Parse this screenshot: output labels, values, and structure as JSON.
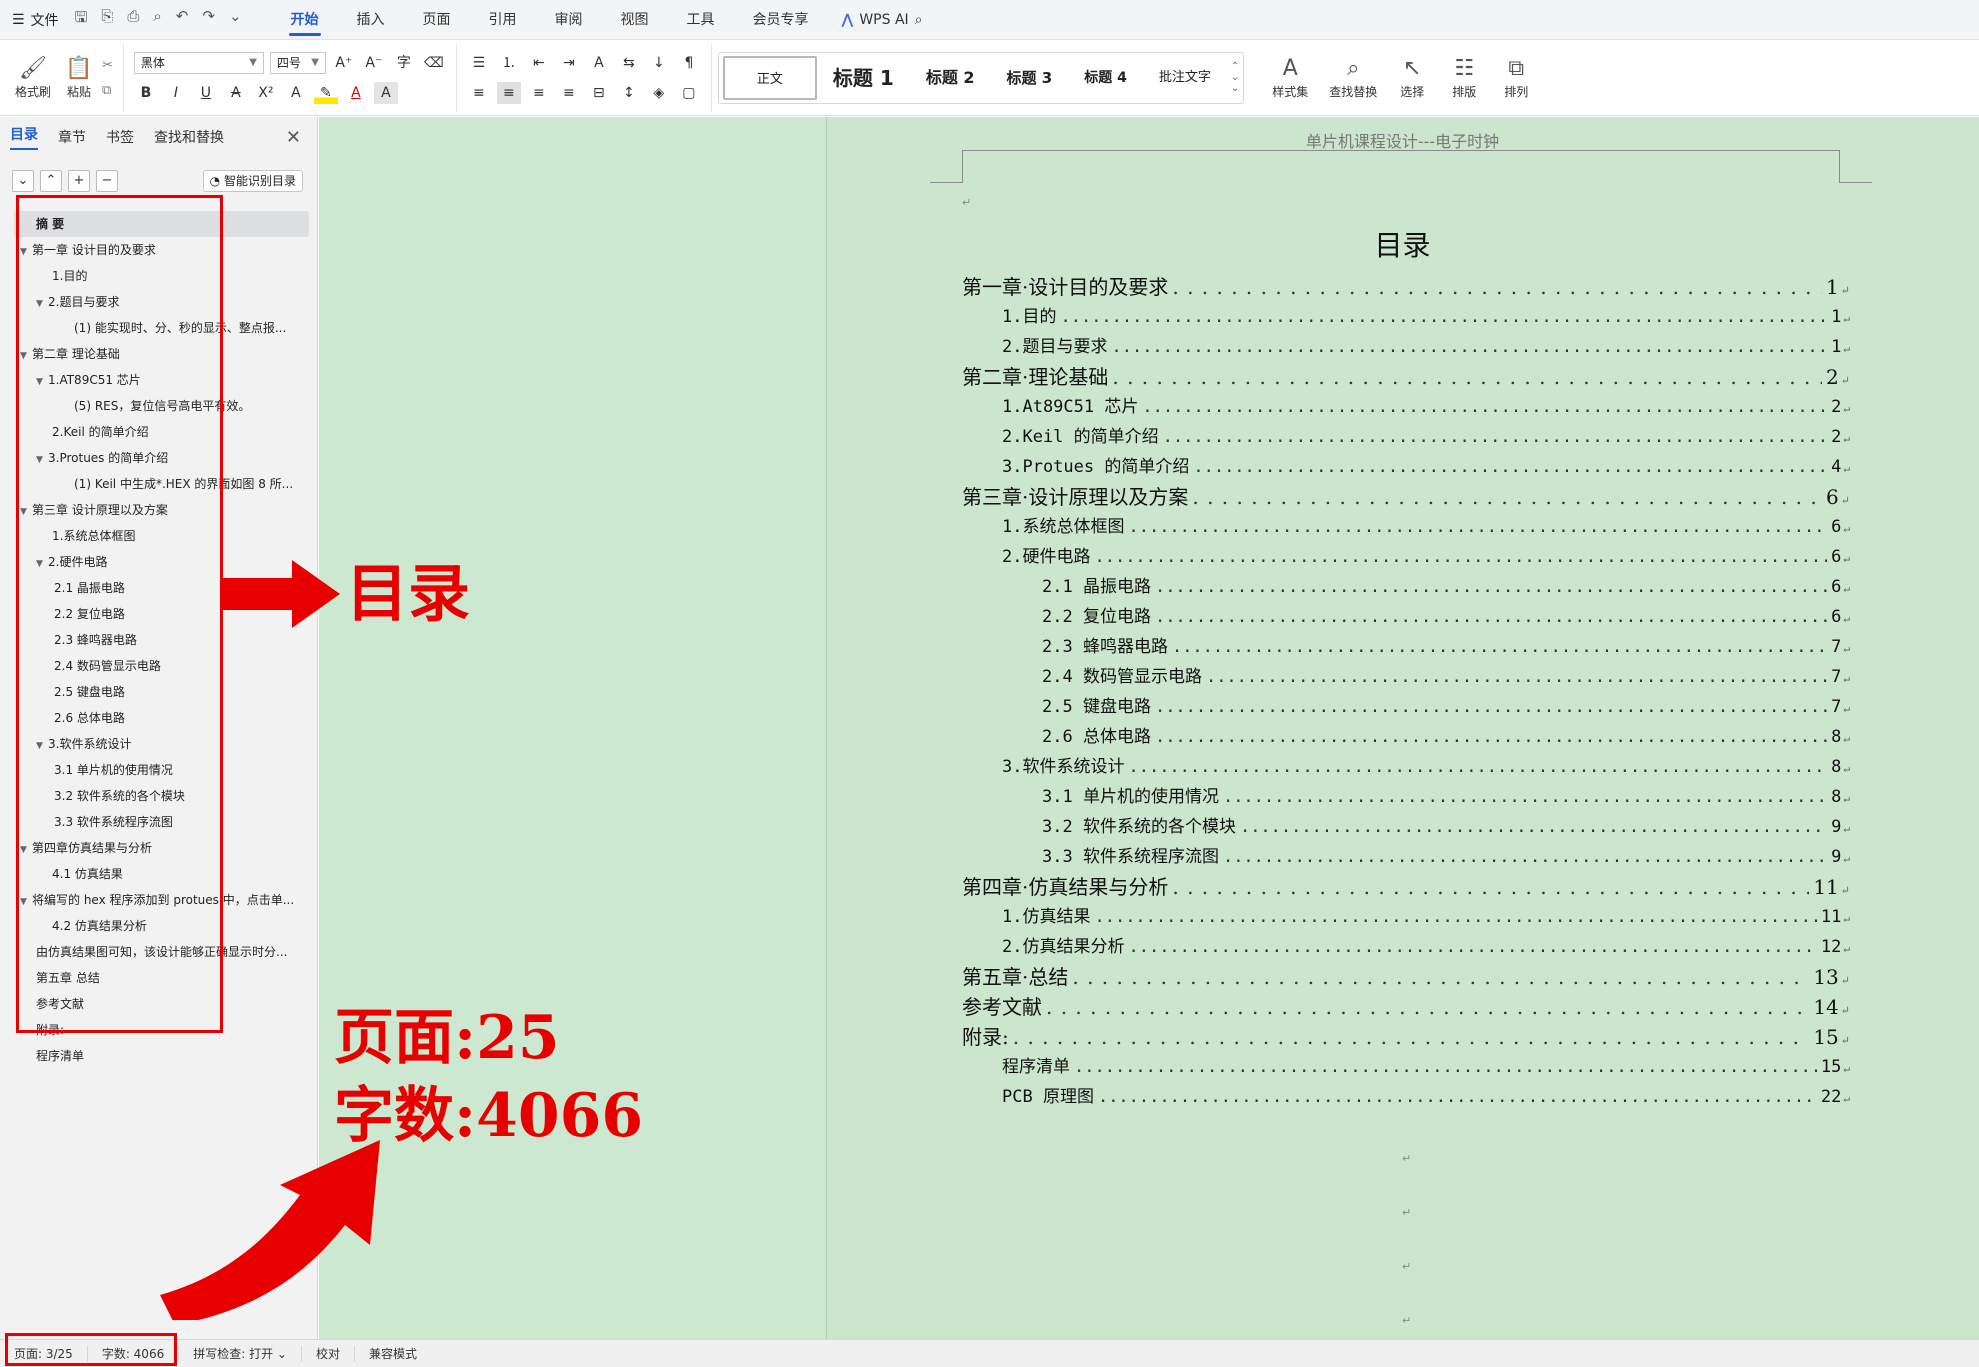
{
  "menubar": {
    "file": "文件",
    "tabs": [
      "开始",
      "插入",
      "页面",
      "引用",
      "审阅",
      "视图",
      "工具",
      "会员专享"
    ],
    "active_tab": "开始",
    "wps_ai": "WPS AI"
  },
  "ribbon": {
    "format_painter": "格式刷",
    "paste": "粘贴",
    "font_name": "黑体",
    "font_size": "四号",
    "styles": [
      "正文",
      "标题 1",
      "标题 2",
      "标题 3",
      "标题 4",
      "批注文字"
    ],
    "style_set": "样式集",
    "find_replace": "查找替换",
    "select": "选择",
    "layout": "排版",
    "arrange": "排列"
  },
  "sidebar": {
    "tabs": [
      "目录",
      "章节",
      "书签",
      "查找和替换"
    ],
    "smart_toc": "智能识别目录",
    "items": [
      {
        "text": "摘  要",
        "level": "sel"
      },
      {
        "text": "第一章 设计目的及要求",
        "level": "1",
        "tri": true
      },
      {
        "text": "1.目的",
        "level": "2n"
      },
      {
        "text": "2.题目与要求",
        "level": "2",
        "tri": true
      },
      {
        "text": "(1) 能实现时、分、秒的显示、整点报...",
        "level": "4"
      },
      {
        "text": "第二章 理论基础",
        "level": "1",
        "tri": true
      },
      {
        "text": "1.AT89C51 芯片",
        "level": "2",
        "tri": true
      },
      {
        "text": "(5) RES，复位信号高电平有效。",
        "level": "4"
      },
      {
        "text": "2.Keil 的简单介绍",
        "level": "2n"
      },
      {
        "text": "3.Protues 的简单介绍",
        "level": "2",
        "tri": true
      },
      {
        "text": "(1) Keil 中生成*.HEX 的界面如图 8 所...",
        "level": "4"
      },
      {
        "text": "第三章 设计原理以及方案",
        "level": "1",
        "tri": true
      },
      {
        "text": "1.系统总体框图",
        "level": "2n"
      },
      {
        "text": "2.硬件电路",
        "level": "2",
        "tri": true
      },
      {
        "text": "2.1 晶振电路",
        "level": "3"
      },
      {
        "text": "2.2 复位电路",
        "level": "3"
      },
      {
        "text": "2.3 蜂鸣器电路",
        "level": "3"
      },
      {
        "text": "2.4 数码管显示电路",
        "level": "3"
      },
      {
        "text": "2.5 键盘电路",
        "level": "3"
      },
      {
        "text": "2.6 总体电路",
        "level": "3"
      },
      {
        "text": "3.软件系统设计",
        "level": "2",
        "tri": true
      },
      {
        "text": "3.1 单片机的使用情况",
        "level": "3"
      },
      {
        "text": "3.2 软件系统的各个模块",
        "level": "3"
      },
      {
        "text": "3.3 软件系统程序流图",
        "level": "3"
      },
      {
        "text": "第四章仿真结果与分析",
        "level": "1",
        "tri": true
      },
      {
        "text": "4.1 仿真结果",
        "level": "2n"
      },
      {
        "text": "将编写的 hex 程序添加到 protues 中，点击单...",
        "level": "1",
        "tri": true
      },
      {
        "text": "4.2 仿真结果分析",
        "level": "2n"
      },
      {
        "text": "由仿真结果图可知，该设计能够正确显示时分...",
        "level": "1n"
      },
      {
        "text": "第五章 总结",
        "level": "1n"
      },
      {
        "text": "参考文献",
        "level": "1n"
      },
      {
        "text": "附录:",
        "level": "1n"
      },
      {
        "text": "程序清单",
        "level": "1n"
      }
    ]
  },
  "document": {
    "header": "单片机课程设计---电子时钟",
    "title": "目录",
    "toc": [
      {
        "text": "第一章·设计目的及要求",
        "page": "1",
        "level": "l1"
      },
      {
        "text": "1.目的",
        "page": "1",
        "level": "l2"
      },
      {
        "text": "2.题目与要求",
        "page": "1",
        "level": "l2"
      },
      {
        "text": "第二章·理论基础",
        "page": "2",
        "level": "l1"
      },
      {
        "text": "1.At89C51 芯片",
        "page": "2",
        "level": "l2"
      },
      {
        "text": "2.Keil 的简单介绍",
        "page": "2",
        "level": "l2"
      },
      {
        "text": "3.Protues 的简单介绍",
        "page": "4",
        "level": "l2"
      },
      {
        "text": "第三章·设计原理以及方案",
        "page": "6",
        "level": "l1"
      },
      {
        "text": "1.系统总体框图",
        "page": "6",
        "level": "l2"
      },
      {
        "text": "2.硬件电路",
        "page": "6",
        "level": "l2"
      },
      {
        "text": "2.1 晶振电路",
        "page": "6",
        "level": "l3"
      },
      {
        "text": "2.2 复位电路",
        "page": "6",
        "level": "l3"
      },
      {
        "text": "2.3 蜂鸣器电路",
        "page": "7",
        "level": "l3"
      },
      {
        "text": "2.4 数码管显示电路",
        "page": "7",
        "level": "l3"
      },
      {
        "text": "2.5 键盘电路",
        "page": "7",
        "level": "l3"
      },
      {
        "text": "2.6 总体电路",
        "page": "8",
        "level": "l3"
      },
      {
        "text": "3.软件系统设计",
        "page": "8",
        "level": "l2"
      },
      {
        "text": "3.1 单片机的使用情况",
        "page": "8",
        "level": "l3"
      },
      {
        "text": "3.2 软件系统的各个模块",
        "page": "9",
        "level": "l3"
      },
      {
        "text": "3.3 软件系统程序流图",
        "page": "9",
        "level": "l3"
      },
      {
        "text": "第四章·仿真结果与分析",
        "page": "11",
        "level": "l1"
      },
      {
        "text": "1.仿真结果",
        "page": "11",
        "level": "l2"
      },
      {
        "text": "2.仿真结果分析",
        "page": "12",
        "level": "l2"
      },
      {
        "text": "第五章·总结",
        "page": "13",
        "level": "l1"
      },
      {
        "text": "参考文献",
        "page": "14",
        "level": "l1"
      },
      {
        "text": "附录:",
        "page": "15",
        "level": "l1"
      },
      {
        "text": "程序清单",
        "page": "15",
        "level": "l2"
      },
      {
        "text": "PCB 原理图",
        "page": "22",
        "level": "l2"
      }
    ]
  },
  "annotations": {
    "toc_label": "目录",
    "pages_label": "页面:25",
    "words_label": "字数:4066",
    "color": "#e80000"
  },
  "statusbar": {
    "page": "页面: 3/25",
    "words": "字数: 4066",
    "spell": "拼写检查: 打开",
    "proof": "校对",
    "compat": "兼容模式"
  },
  "colors": {
    "accent": "#1f5fd6",
    "doc_bg": "#cde8d0",
    "annotation": "#e80000"
  }
}
